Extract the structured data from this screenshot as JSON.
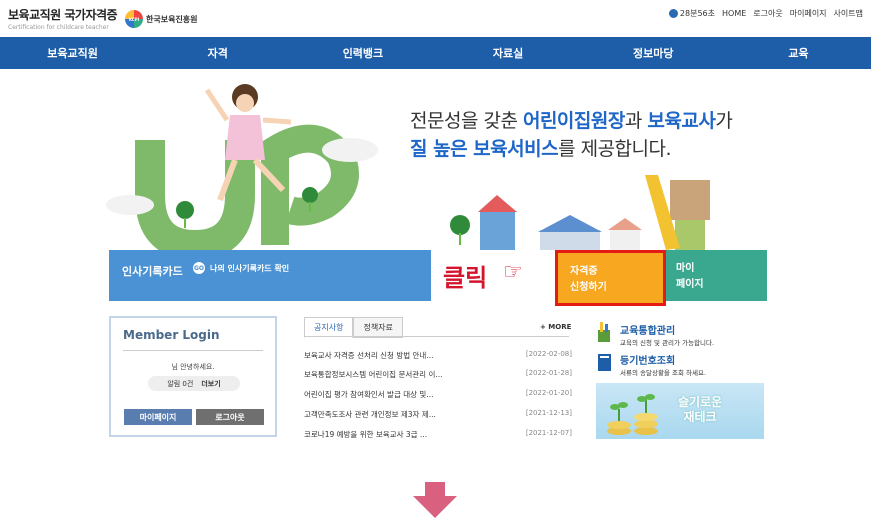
{
  "header": {
    "logo_title": "보육교직원 국가자격증",
    "logo_sub": "Certification for childcare teacher",
    "partner_mark": "KCPI",
    "partner_name": "한국보육진흥원",
    "timer": "28분56초",
    "links": [
      "HOME",
      "로그아웃",
      "마이페이지",
      "사이트맵"
    ]
  },
  "nav": [
    "보육교직원",
    "자격",
    "인력뱅크",
    "자료실",
    "정보마당",
    "교육"
  ],
  "hero": {
    "line1_pre": "전문성을 갖춘 ",
    "line1_hl1": "어린이집원장",
    "line1_mid": "과 ",
    "line1_hl2": "보육교사",
    "line1_post": "가",
    "line2_hl": "질 높은 보육서비스",
    "line2_post": "를 제공합니다."
  },
  "banners": {
    "card_label": "인사기록카드",
    "card_go": "GO",
    "card_sub": "나의 인사기록카드 확인",
    "click_text": "클릭",
    "hand": "☞",
    "apply_label": "자격증\n신청하기",
    "mypage_label": "마이\n페이지"
  },
  "login": {
    "title": "Member Login",
    "greeting": "님 안녕하세요.",
    "alert_label": "알림 0건",
    "alert_more": "더보기",
    "btn_mypage": "마이페이지",
    "btn_logout": "로그아웃"
  },
  "notices": {
    "tabs": [
      "공지사항",
      "정책자료"
    ],
    "more": "+ MORE",
    "items": [
      {
        "title": "보육교사 자격증 선처리 신청 방법 안내...",
        "date": "[2022-02-08]"
      },
      {
        "title": "보육통합정보시스템 어린이집 문서관리 이...",
        "date": "[2022-01-28]"
      },
      {
        "title": "어린이집 평가 참여확인서 발급 대상 및...",
        "date": "[2022-01-20]"
      },
      {
        "title": "고객만족도조사 관련 개인정보 제3자 제...",
        "date": "[2021-12-13]"
      },
      {
        "title": "코로나19 예방을 위한 보육교사 3급 ...",
        "date": "[2021-12-07]"
      }
    ]
  },
  "side_links": [
    {
      "title": "교육통합관리",
      "desc": "교육의 신청 및 관리가 가능합니다."
    },
    {
      "title": "등기번호조회",
      "desc": "서류의 송달상황을 조회 하세요."
    }
  ],
  "ad": {
    "text": "슬기로운\n재테크"
  },
  "colors": {
    "nav": "#1e5ea8",
    "accent": "#1e66c8",
    "apply": "#f8a820",
    "mypage": "#3aa88e",
    "highlight_border": "#e31b14",
    "arrow": "#d9607f"
  }
}
